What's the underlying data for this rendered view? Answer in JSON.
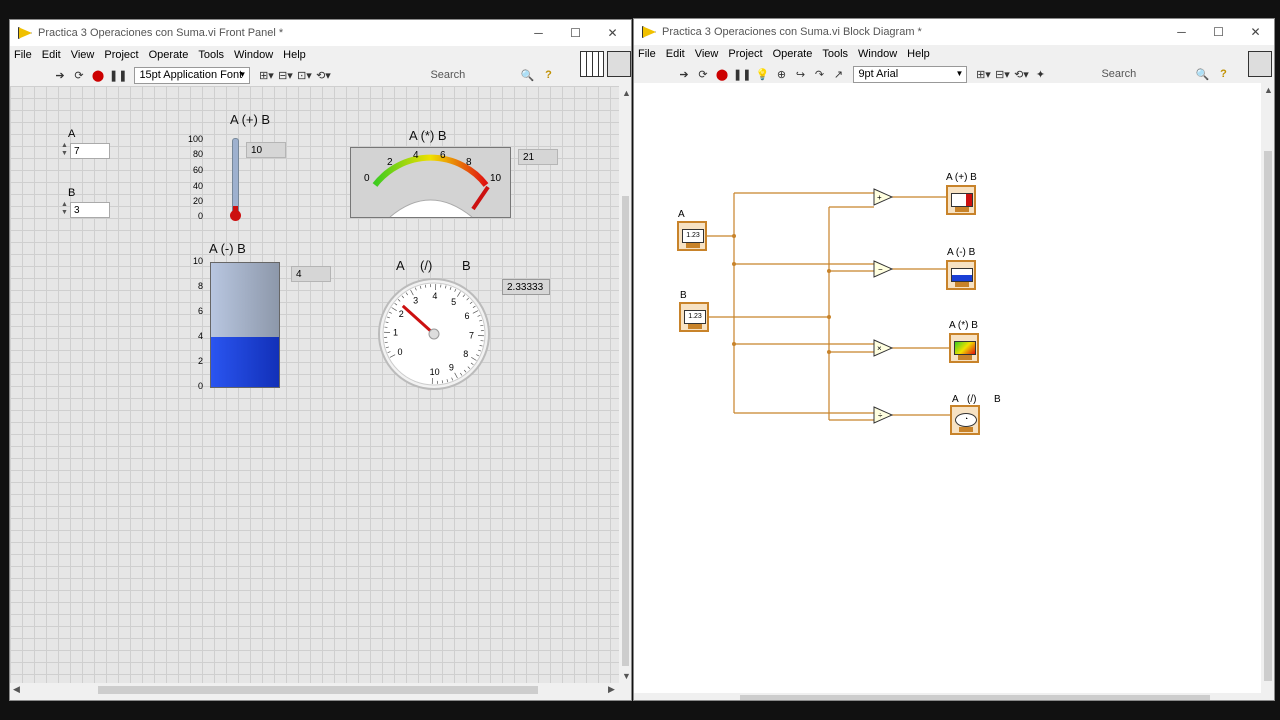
{
  "front_panel": {
    "title": "Practica 3 Operaciones con Suma.vi Front Panel *",
    "menu": [
      "File",
      "Edit",
      "View",
      "Project",
      "Operate",
      "Tools",
      "Window",
      "Help"
    ],
    "font": "15pt Application Font",
    "search_placeholder": "Search",
    "controls": {
      "a_label": "A",
      "a_value": "7",
      "b_label": "B",
      "b_value": "3"
    },
    "sum": {
      "label": "A (+) B",
      "value": "10",
      "ticks": [
        "100",
        "80",
        "60",
        "40",
        "20",
        "0"
      ],
      "level": 10,
      "max": 100
    },
    "diff": {
      "label": "A (-) B",
      "value": "4",
      "ticks": [
        "10",
        "8",
        "6",
        "4",
        "2",
        "0"
      ],
      "level": 4,
      "max": 10
    },
    "product": {
      "label": "A (*) B",
      "value": "21",
      "ticks": [
        "0",
        "2",
        "4",
        "6",
        "8",
        "10"
      ]
    },
    "quotient": {
      "label_a": "A",
      "label_op": "(/)",
      "label_b": "B",
      "value": "2.33333",
      "ticks": [
        "0",
        "1",
        "2",
        "3",
        "4",
        "5",
        "6",
        "7",
        "8",
        "9",
        "10"
      ],
      "level": 2.33333
    }
  },
  "block_diagram": {
    "title": "Practica 3 Operaciones con Suma.vi Block Diagram *",
    "menu": [
      "File",
      "Edit",
      "View",
      "Project",
      "Operate",
      "Tools",
      "Window",
      "Help"
    ],
    "font": "9pt Arial",
    "search_placeholder": "Search",
    "terminals": {
      "a_label": "A",
      "b_label": "B",
      "sum_label": "A (+) B",
      "diff_label": "A (-) B",
      "prod_label": "A (*) B",
      "quot_label_a": "A",
      "quot_label_op": "(/)",
      "quot_label_b": "B"
    },
    "wire_color": "#c8832a"
  },
  "colors": {
    "thermo": "#cc1010",
    "tank": "#1a3fd6",
    "tank_empty": "#aab8d8",
    "gauge_needle": "#cc1010"
  }
}
